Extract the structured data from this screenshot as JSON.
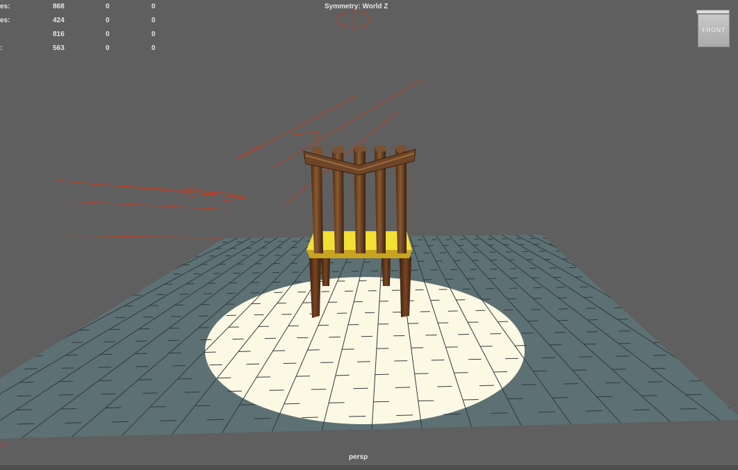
{
  "stats": [
    {
      "label": "es:",
      "v1": "868",
      "v2": "0",
      "v3": "0"
    },
    {
      "label": "es:",
      "v1": "424",
      "v2": "0",
      "v3": "0"
    },
    {
      "label": "",
      "v1": "816",
      "v2": "0",
      "v3": "0"
    },
    {
      "label": ":",
      "v1": "563",
      "v2": "0",
      "v3": "0"
    }
  ],
  "symmetry": "Symmetry: World Z",
  "camera": "persp",
  "viewcube_label": "FRONT",
  "axis_marker": "x",
  "colors": {
    "viewport_bg": "#5f5f5f",
    "floor": "#5d7073",
    "spotlight": "#fbf8e4",
    "light_lines": "#c23a1c",
    "chair_wood": "#6b3d1c",
    "chair_highlight": "#f2e035"
  }
}
